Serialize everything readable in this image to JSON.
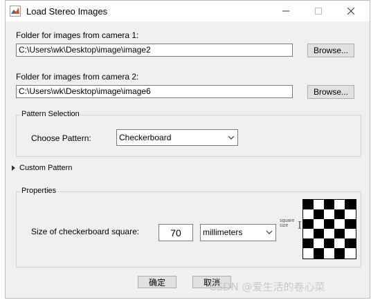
{
  "window": {
    "title": "Load Stereo Images",
    "icon": "matlab-icon",
    "controls": [
      "minimize-icon",
      "maximize-icon",
      "close-icon"
    ]
  },
  "camera1": {
    "label": "Folder for images from camera 1:",
    "path": "C:\\Users\\wk\\Desktop\\image\\image2",
    "browse_label": "Browse..."
  },
  "camera2": {
    "label": "Folder for images from camera 2:",
    "path": "C:\\Users\\wk\\Desktop\\image\\image6",
    "browse_label": "Browse..."
  },
  "pattern_selection": {
    "title": "Pattern Selection",
    "choose_label": "Choose Pattern:",
    "selected": "Checkerboard"
  },
  "custom_pattern": {
    "label": "Custom Pattern"
  },
  "properties": {
    "title": "Properties",
    "size_label": "Size of checkerboard square:",
    "size_value": "70",
    "units": "millimeters",
    "square_size_annotation": "square size"
  },
  "footer": {
    "ok_label": "确定",
    "cancel_label": "取消"
  },
  "watermark": "CSDN @爱生活的卷心菜",
  "colors": {
    "dialog_bg": "#f0f0f0",
    "button_bg": "#e1e1e1",
    "border": "#adadad"
  }
}
